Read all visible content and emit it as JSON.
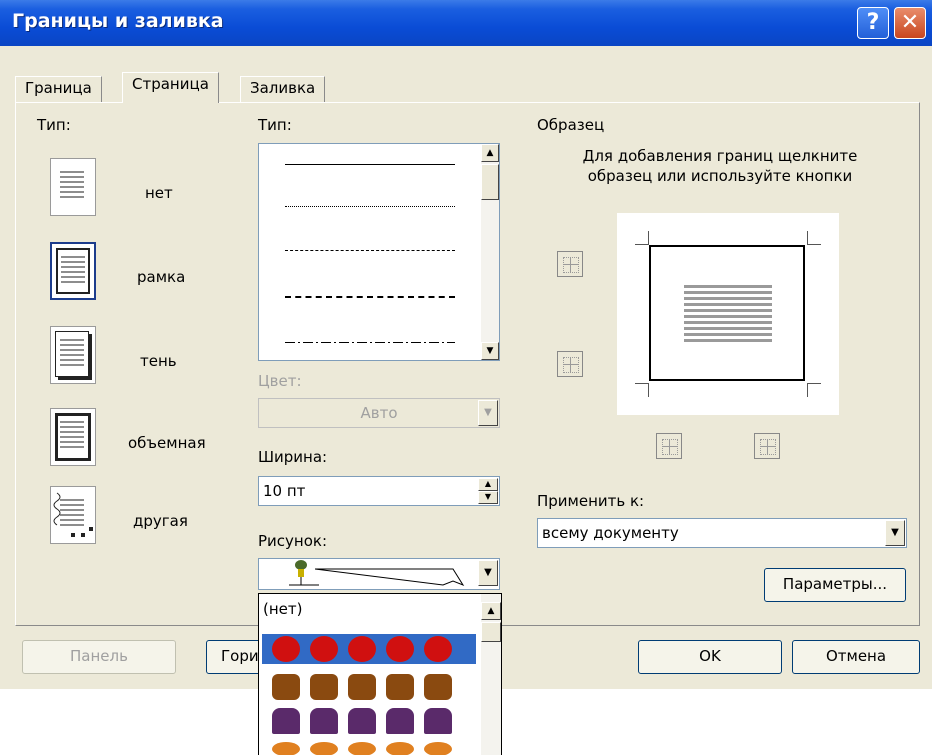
{
  "window": {
    "title": "Границы и заливка",
    "help_glyph": "?",
    "close_glyph": "✕"
  },
  "tabs": [
    {
      "label": "Граница",
      "active": false
    },
    {
      "label": "Страница",
      "active": true
    },
    {
      "label": "Заливка",
      "active": false
    }
  ],
  "type_section": {
    "label": "Тип:",
    "presets": [
      {
        "label": "нет",
        "icon": "page-none-icon"
      },
      {
        "label": "рамка",
        "icon": "page-box-icon",
        "selected": true
      },
      {
        "label": "тень",
        "icon": "page-shadow-icon"
      },
      {
        "label": "объемная",
        "icon": "page-3d-icon"
      },
      {
        "label": "другая",
        "icon": "page-custom-icon"
      }
    ]
  },
  "style_section": {
    "label": "Тип:",
    "line_styles": [
      "solid",
      "dotted",
      "dashed",
      "long-dashed",
      "dash-dot"
    ],
    "color_label": "Цвет:",
    "color_value": "Авто",
    "width_label": "Ширина:",
    "width_value": "10 пт",
    "art_label": "Рисунок:",
    "art_list": {
      "none_label": "(нет)",
      "items": [
        "red-circles",
        "muffins",
        "cakes",
        "candies"
      ]
    }
  },
  "preview": {
    "label": "Образец",
    "hint": "Для добавления границ щелкните образец или используйте кнопки"
  },
  "apply_to": {
    "label": "Применить к:",
    "value": "всему документу"
  },
  "buttons": {
    "options": "Параметры...",
    "panel": "Панель",
    "horizontal_partial": "Гори",
    "ok": "OK",
    "cancel": "Отмена"
  },
  "colors": {
    "titlebar": "#0a4cd6",
    "dialog_bg": "#ece9d8",
    "selection": "#316ac5"
  }
}
